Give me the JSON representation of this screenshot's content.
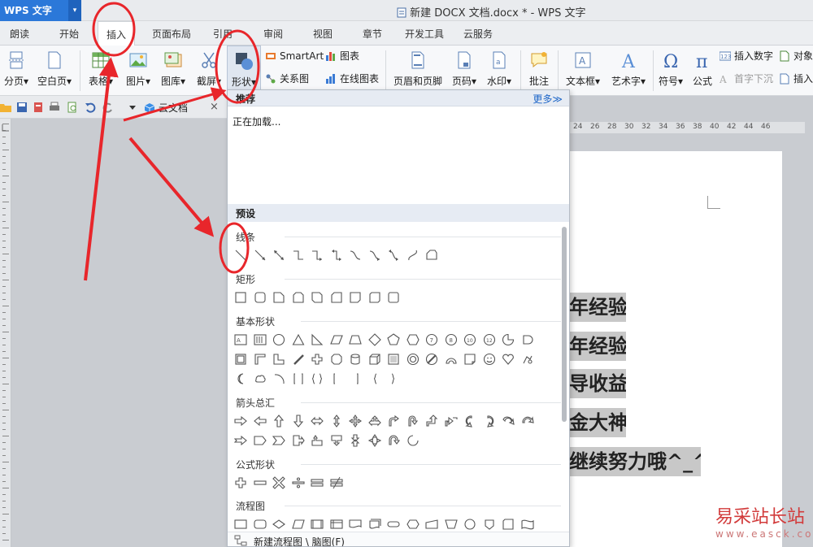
{
  "titlebar": {
    "app_name": "WPS 文字",
    "app_arrow": "▾",
    "document_title": "新建 DOCX 文档.docx * - WPS 文字"
  },
  "tabs": [
    "朗读",
    "开始",
    "插入",
    "页面布局",
    "引用",
    "审阅",
    "视图",
    "章节",
    "开发工具",
    "云服务"
  ],
  "active_tab": "插入",
  "ribbon": {
    "pagination": "分页",
    "blank_page": "空白页",
    "table": "表格",
    "picture": "图片",
    "gallery": "图库",
    "screenshot": "截屏",
    "shapes": "形状",
    "smartart": "SmartArt",
    "chart": "图表",
    "relation_chart": "关系图",
    "online_chart": "在线图表",
    "header_footer": "页眉和页脚",
    "page_number": "页码",
    "watermark": "水印",
    "comment": "批注",
    "textbox": "文本框",
    "wordart": "艺术字",
    "symbol": "符号",
    "formula": "公式",
    "insert_number": "插入数字",
    "object": "对象",
    "drop_cap": "首字下沉",
    "insert_more": "插入",
    "dropdown_caret": "▾"
  },
  "quickbar": {
    "cloud_doc": "云文档",
    "close": "×"
  },
  "ruler": [
    "24",
    "26",
    "28",
    "30",
    "32",
    "34",
    "36",
    "38",
    "40",
    "42",
    "44",
    "46"
  ],
  "document_lines": [
    "年经验",
    "年经验",
    "导收益",
    "金大神",
    "继续努力哦^_^"
  ],
  "dropdown": {
    "recommended": "推荐",
    "more": "更多≫",
    "loading": "正在加载...",
    "preset": "预设",
    "sections": {
      "lines": "线条",
      "rectangles": "矩形",
      "basic": "基本形状",
      "arrows": "箭头总汇",
      "formula": "公式形状",
      "flowchart": "流程图"
    },
    "footer": "新建流程图 \\ 脑图(F)"
  },
  "watermark": {
    "site_name": "易采站长站",
    "url": "www.easck.com"
  },
  "colors": {
    "accent": "#2b78d9",
    "annotation": "#e8262b"
  }
}
